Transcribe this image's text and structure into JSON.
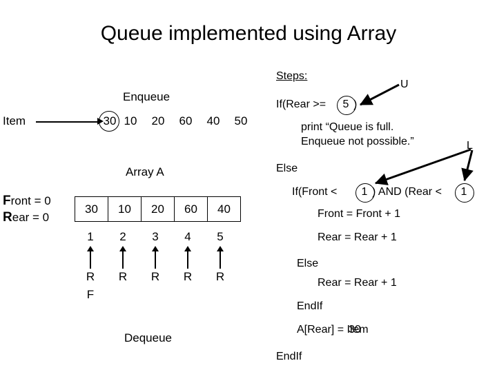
{
  "slide": {
    "title": "Queue implemented using Array"
  },
  "diagram": {
    "enqueue_label": "Enqueue",
    "dequeue_label": "Dequeue",
    "item_label": "Item",
    "array_label": "Array A",
    "incoming_stream": [
      "30",
      "10",
      "20",
      "60",
      "40",
      "50"
    ],
    "highlighted_item": "30",
    "front_label": "Front = 0",
    "front_prefix": "F",
    "front_rest": "ront = 0",
    "rear_label": "Rear = 0",
    "rear_prefix": "R",
    "rear_rest": "ear = 0",
    "array_cells": [
      "30",
      "10",
      "20",
      "60",
      "40"
    ],
    "indices": [
      "1",
      "2",
      "3",
      "4",
      "5"
    ],
    "pointer_marks": [
      "R",
      "R",
      "R",
      "R",
      "R"
    ],
    "front_mark": "F"
  },
  "pseudocode": {
    "steps_heading": "Steps:",
    "line_if_rear": "If(Rear >=",
    "circled_upper_bound": "5",
    "closing_paren": ")",
    "line_print_1": "print “Queue is full.",
    "line_print_2": "Enqueue not possible.”",
    "line_else_1": "Else",
    "line_if_front_a": "If(Front <",
    "circled_lower_front": "1",
    "line_if_front_b": ") AND (Rear <",
    "circled_lower_rear": "1",
    "line_front_inc": "Front = Front + 1",
    "line_rear_inc_1": "Rear = Rear + 1",
    "line_else_2": "Else",
    "line_rear_inc_2": "Rear = Rear + 1",
    "line_endif_1": "EndIf",
    "line_assign": "A[Rear] = Item",
    "line_assign_overlay": "30",
    "line_endif_2": "EndIf"
  },
  "annotations": {
    "upper_bound_marker": "U",
    "lower_bound_marker": "L"
  },
  "colors": {
    "background": "#ffffff",
    "ink": "#000000"
  }
}
